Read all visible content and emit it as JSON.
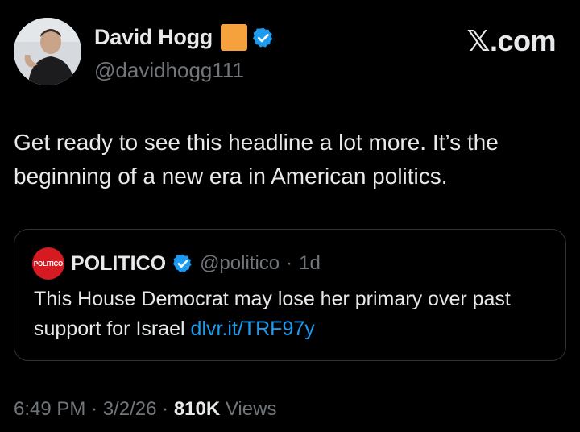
{
  "author": {
    "name": "David Hogg",
    "handle": "@davidhogg111",
    "flag_color": "#f5a13c"
  },
  "site": {
    "logo_text": "𝕏.com"
  },
  "tweet": {
    "text": "Get ready to see this headline a lot more. It’s the beginning of a new era in American politics."
  },
  "quote": {
    "logo_text": "POLITICO",
    "name": "POLITICO",
    "handle": "@politico",
    "separator": "·",
    "age": "1d",
    "text": "This House Democrat may lose her primary over past support for Israel",
    "link": "dlvr.it/TRF97y"
  },
  "meta": {
    "time": "6:49 PM",
    "sep1": "·",
    "date": "3/2/26",
    "sep2": "·",
    "views_count": "810K",
    "views_label": "Views"
  },
  "colors": {
    "background": "#000000",
    "text": "#e7e9ea",
    "muted": "#71767b",
    "link": "#1d9bf0",
    "verified": "#1d9bf0",
    "politico_red": "#d61a21"
  }
}
